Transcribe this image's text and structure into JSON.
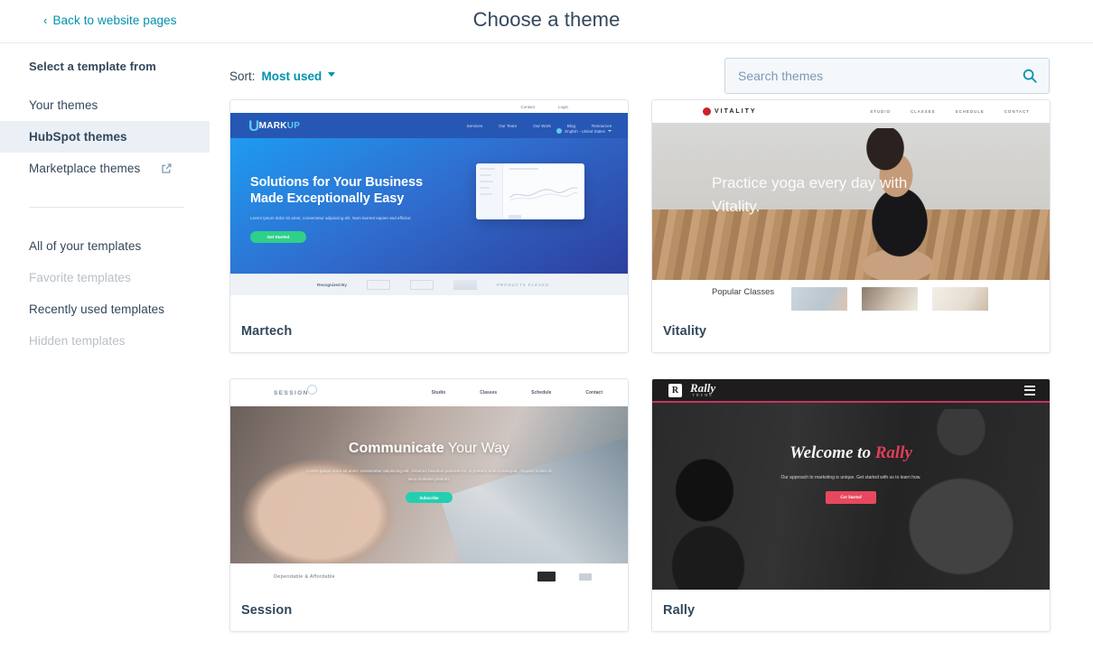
{
  "header": {
    "back_link": "Back to website pages",
    "back_chevron": "‹",
    "title": "Choose a theme"
  },
  "sidebar": {
    "heading": "Select a template from",
    "items": [
      {
        "label": "Your themes",
        "selected": false,
        "muted": false
      },
      {
        "label": "HubSpot themes",
        "selected": true,
        "muted": false
      },
      {
        "label": "Marketplace themes",
        "selected": false,
        "muted": false,
        "icon": "external-link-icon"
      }
    ],
    "items2": [
      {
        "label": "All of your templates",
        "muted": false
      },
      {
        "label": "Favorite templates",
        "muted": true
      },
      {
        "label": "Recently used templates",
        "muted": false
      },
      {
        "label": "Hidden templates",
        "muted": true
      }
    ]
  },
  "toolbar": {
    "sort_label": "Sort:",
    "sort_value": "Most used",
    "search_placeholder": "Search themes",
    "search_value": "",
    "search_icon": "search-icon"
  },
  "colors": {
    "accent_teal": "#0091ae",
    "selected_bg": "#eaf0f6",
    "text": "#33475b"
  },
  "cards": [
    {
      "name": "Martech",
      "preview": {
        "utility_links": [
          "Contact",
          "Login"
        ],
        "logo_u": "U",
        "logo_main": "MARK",
        "logo_accent": "UP",
        "nav": [
          "Services",
          "Our Team",
          "Our Work",
          "Blog",
          "Resources"
        ],
        "language": "English - United States",
        "headline_line1": "Solutions for Your Business",
        "headline_line2": "Made Exceptionally Easy",
        "sub": "Lorem ipsum dolor sit amet, consectetur adipiscing elit. Nam laoreet sapien sed efficitur.",
        "cta": "Get Started",
        "footer_label": "Recognized By",
        "footer_logo_text": "PRODUCTS FLEXED"
      }
    },
    {
      "name": "Vitality",
      "preview": {
        "logo": "VITALITY",
        "nav": [
          "STUDIO",
          "CLASSES",
          "SCHEDULE",
          "CONTACT"
        ],
        "headline": "Practice yoga every day with Vitality.",
        "section_label": "Popular Classes"
      }
    },
    {
      "name": "Session",
      "preview": {
        "logo": "SESSION",
        "nav": [
          "Studio",
          "Classes",
          "Schedule",
          "Contact"
        ],
        "headline_bold": "Communicate",
        "headline_rest": " Your Way",
        "sub": "Lorem ipsum dolor sit amet, consectetur adipiscing elit. Vivamus faucibus posuere mi, in pretium ante consequat. Aliquam a duis id arcu molestie pretium.",
        "cta": "Subscribe",
        "footer_label": "Dependable & Affordable"
      }
    },
    {
      "name": "Rally",
      "preview": {
        "logo": "Rally",
        "logo_sub": "THEME",
        "logo_mark": "R",
        "menu_icon": "hamburger-menu-icon",
        "headline_prefix": "Welcome to ",
        "headline_accent": "Rally",
        "sub": "Our approach to marketing is unique. Get started with us to learn how.",
        "cta": "Get Started"
      }
    }
  ]
}
